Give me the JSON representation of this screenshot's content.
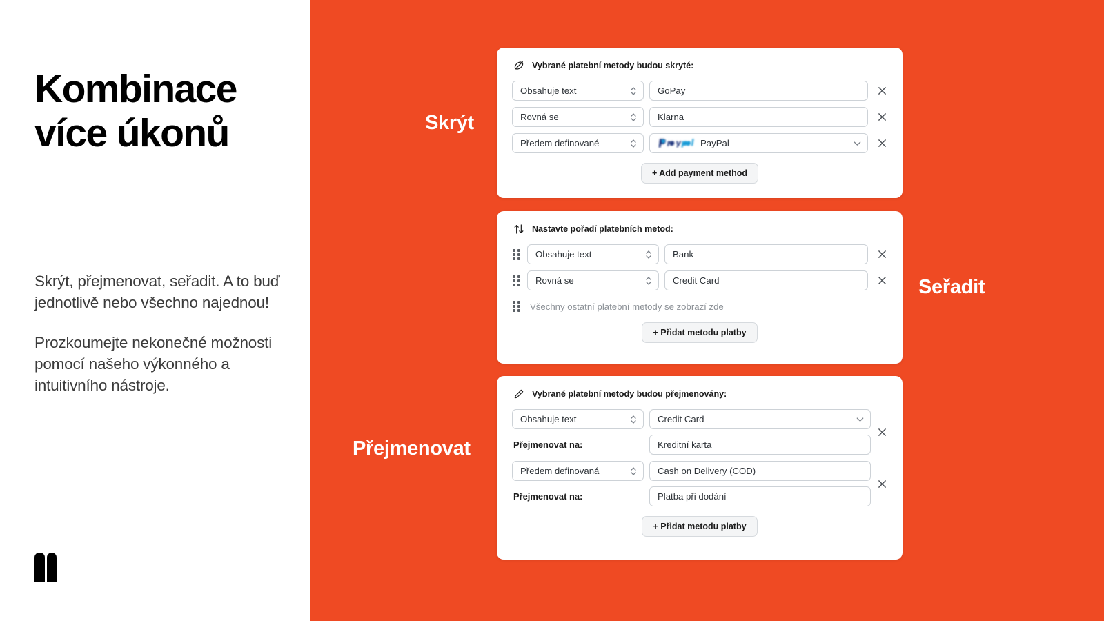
{
  "left": {
    "headline": "Kombinace\nvíce úkonů",
    "paragraphs": [
      "Skrýt, přejmenovat, seřadit. A to buď jednotlivě nebo všechno najednou!",
      "Prozkoumejte nekonečné možnosti pomocí našeho výkonného a intuitivního nástroje."
    ],
    "logo_name": "two-bars-logo"
  },
  "colors": {
    "accent_orange": "#ef4a23",
    "text_dark": "#1b1b1b",
    "body_gray": "#3b3b3b",
    "border_gray": "#cdd2d7",
    "placeholder_gray": "#8b9096"
  },
  "tags": {
    "hide": "Skrýt",
    "sort": "Seřadit",
    "rename": "Přejmenovat"
  },
  "cards": {
    "hide": {
      "icon": "eye-off-icon",
      "title": "Vybrané platební metody budou skryté:",
      "rows": [
        {
          "condition": "Obsahuje text",
          "value": "GoPay",
          "has_chevron": false,
          "has_logo": false
        },
        {
          "condition": "Rovná se",
          "value": "Klarna",
          "has_chevron": false,
          "has_logo": false
        },
        {
          "condition": "Předem definované",
          "value": "PayPal",
          "has_chevron": true,
          "has_logo": true,
          "logo": "paypal-logo"
        }
      ],
      "add_label": "+ Add payment method"
    },
    "sort": {
      "icon": "sort-arrows-icon",
      "title": "Nastavte pořadí platebních metod:",
      "rows": [
        {
          "condition": "Obsahuje text",
          "value": "Bank"
        },
        {
          "condition": "Rovná se",
          "value": "Credit Card"
        }
      ],
      "rest_label": "Všechny ostatní platební metody se zobrazí zde",
      "add_label": "+ Přidat metodu platby"
    },
    "rename": {
      "icon": "pencil-icon",
      "title": "Vybrané platební metody budou přejmenovány:",
      "groups": [
        {
          "condition": "Obsahuje text",
          "value": "Credit Card",
          "has_chevron": true,
          "rename_label": "Přejmenovat na:",
          "rename_value": "Kreditní karta"
        },
        {
          "condition": "Předem definovaná",
          "value": "Cash on Delivery (COD)",
          "has_chevron": false,
          "rename_label": "Přejmenovat na:",
          "rename_value": "Platba při dodání"
        }
      ],
      "add_label": "+ Přidat metodu platby"
    }
  }
}
